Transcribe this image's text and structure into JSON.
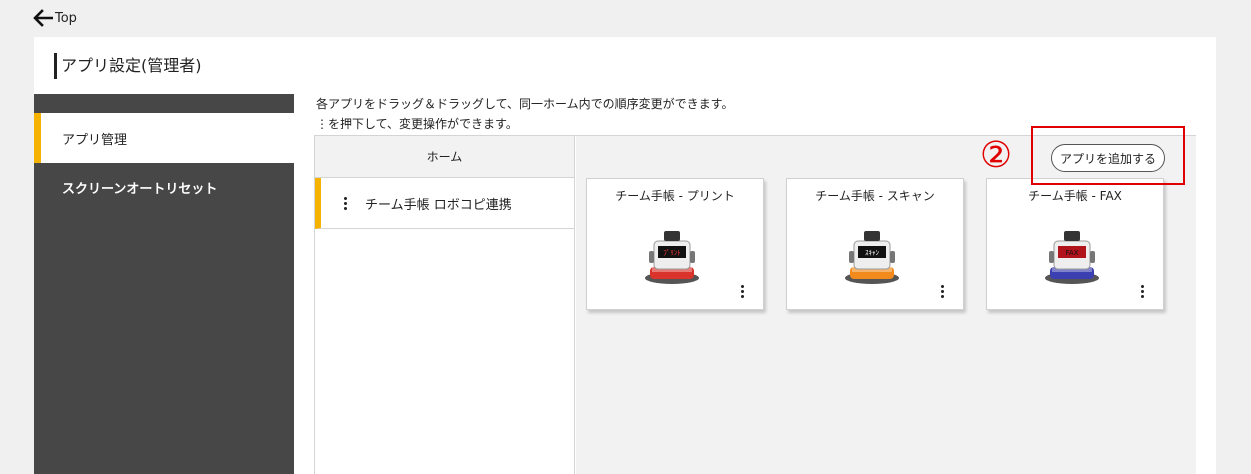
{
  "nav": {
    "back_label": "Top"
  },
  "page": {
    "title": "アプリ設定(管理者)"
  },
  "sidebar": {
    "items": [
      {
        "label": "アプリ管理"
      },
      {
        "label": "スクリーンオートリセット"
      }
    ]
  },
  "instructions": {
    "line1": "各アプリをドラッグ＆ドラッグして、同一ホーム内での順序変更ができます。",
    "line2": "⋮を押下して、変更操作ができます。"
  },
  "home_list": {
    "header": "ホーム",
    "items": [
      {
        "label": "チーム手帳 ロボコピ連携"
      }
    ]
  },
  "apps": {
    "add_button": "アプリを追加する",
    "cards": [
      {
        "title": "チーム手帳 - プリント",
        "accent": "#d9332b",
        "screen_text": "プリント"
      },
      {
        "title": "チーム手帳 - スキャン",
        "accent": "#f28a1c",
        "screen_text": "スキャン"
      },
      {
        "title": "チーム手帳 - FAX",
        "accent": "#3b3fb0",
        "screen_text": "FAX"
      }
    ]
  },
  "annotation": {
    "step_number": "②",
    "color": "#e00000"
  },
  "colors": {
    "accent": "#f5b300",
    "sidebar": "#474747"
  }
}
